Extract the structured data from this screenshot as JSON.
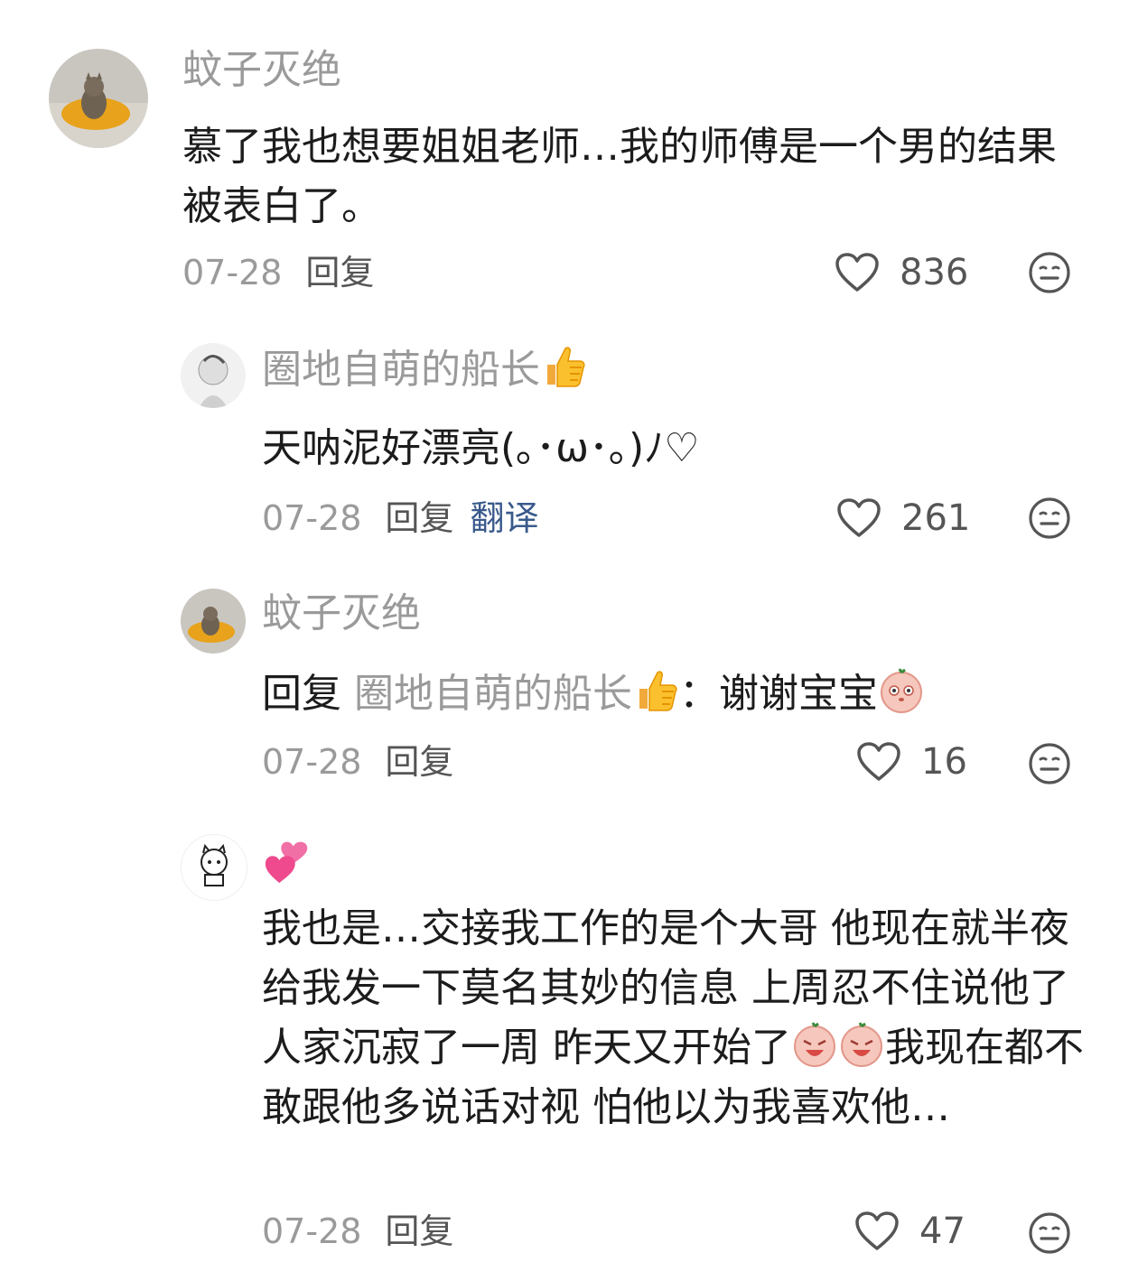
{
  "comments": [
    {
      "user": "蚊子灭绝",
      "text": "慕了我也想要姐姐老师…我的师傅是一个男的结果被表白了。",
      "date": "07-28",
      "reply_label": "回复",
      "likes": "836"
    },
    {
      "user": "圈地自萌的船长",
      "user_emoji": "thumbs-up",
      "text": "天呐泥好漂亮(｡･ω･｡)ﾉ♡",
      "date": "07-28",
      "reply_label": "回复",
      "translate_label": "翻译",
      "likes": "261"
    },
    {
      "user": "蚊子灭绝",
      "reply_prefix": "回复",
      "reply_target": "圈地自萌的船长",
      "reply_colon": "：",
      "text": "谢谢宝宝",
      "date": "07-28",
      "reply_label": "回复",
      "likes": "16"
    },
    {
      "user_emoji": "two-hearts",
      "text_1": "我也是…交接我工作的是个大哥 他现在就半夜给我发一下莫名其妙的信息 上周忍不住说他了 人家沉寂了一周 昨天又开始了",
      "text_2": "我现在都不敢跟他多说话对视 怕他以为我喜欢他…",
      "date": "07-28",
      "reply_label": "回复",
      "likes": "47"
    }
  ],
  "colors": {
    "name": "#9a9a9a",
    "text": "#1c1c1c",
    "translate": "#3a5a8c",
    "icon": "#555555"
  }
}
